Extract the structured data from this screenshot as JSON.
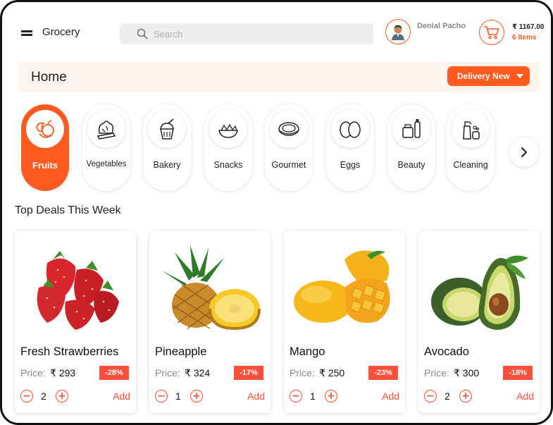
{
  "header": {
    "app_title": "Grocery",
    "search_placeholder": "Search",
    "user_name": "Denial Pacho",
    "cart_total": "₹ 1167.00",
    "cart_items": "6 Items"
  },
  "home": {
    "title": "Home",
    "delivery_button": "Delivery New"
  },
  "categories": [
    {
      "label": "Fruits",
      "icon": "fruits-icon",
      "active": true
    },
    {
      "label": "Vegetables",
      "icon": "vegetables-icon"
    },
    {
      "label": "Bakery",
      "icon": "bakery-icon"
    },
    {
      "label": "Snacks",
      "icon": "snacks-icon"
    },
    {
      "label": "Gourmet",
      "icon": "gourmet-icon"
    },
    {
      "label": "Eggs",
      "icon": "eggs-icon"
    },
    {
      "label": "Beauty",
      "icon": "beauty-icon"
    },
    {
      "label": "Cleaning",
      "icon": "cleaning-icon"
    }
  ],
  "section_title": "Top Deals This Week",
  "products": [
    {
      "name": "Fresh Strawberries",
      "price_label": "Price:",
      "price": "₹ 293",
      "discount": "-28%",
      "qty": "2",
      "add": "Add"
    },
    {
      "name": "Pineapple",
      "price_label": "Price:",
      "price": "₹ 324",
      "discount": "-17%",
      "qty": "1",
      "add": "Add"
    },
    {
      "name": "Mango",
      "price_label": "Price:",
      "price": "₹ 250",
      "discount": "-23%",
      "qty": "1",
      "add": "Add"
    },
    {
      "name": "Avocado",
      "price_label": "Price:",
      "price": "₹ 300",
      "discount": "-18%",
      "qty": "2",
      "add": "Add"
    }
  ],
  "colors": {
    "accent": "#ff5a1f",
    "discount": "#ff4f3a",
    "home_bar": "#fff3ee"
  }
}
